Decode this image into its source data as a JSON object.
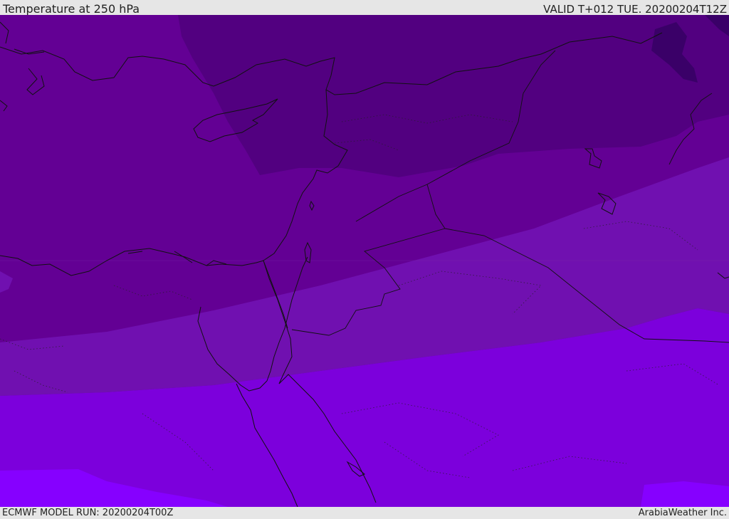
{
  "header": {
    "title": "Temperature at 250 hPa",
    "valid": "VALID T+012 TUE. 20200204T12Z"
  },
  "footer": {
    "model_run": "ECMWF MODEL RUN: 20200204T00Z",
    "credit": "ArabiaWeather Inc."
  },
  "colors": {
    "band_coldest": "#3a0068",
    "band_very_cold": "#520080",
    "band_cold": "#630094",
    "band_mid": "#7010b0",
    "band_warm": "#7c00dc",
    "band_warmest": "#8600ff",
    "frame": "#e6e6e6"
  }
}
